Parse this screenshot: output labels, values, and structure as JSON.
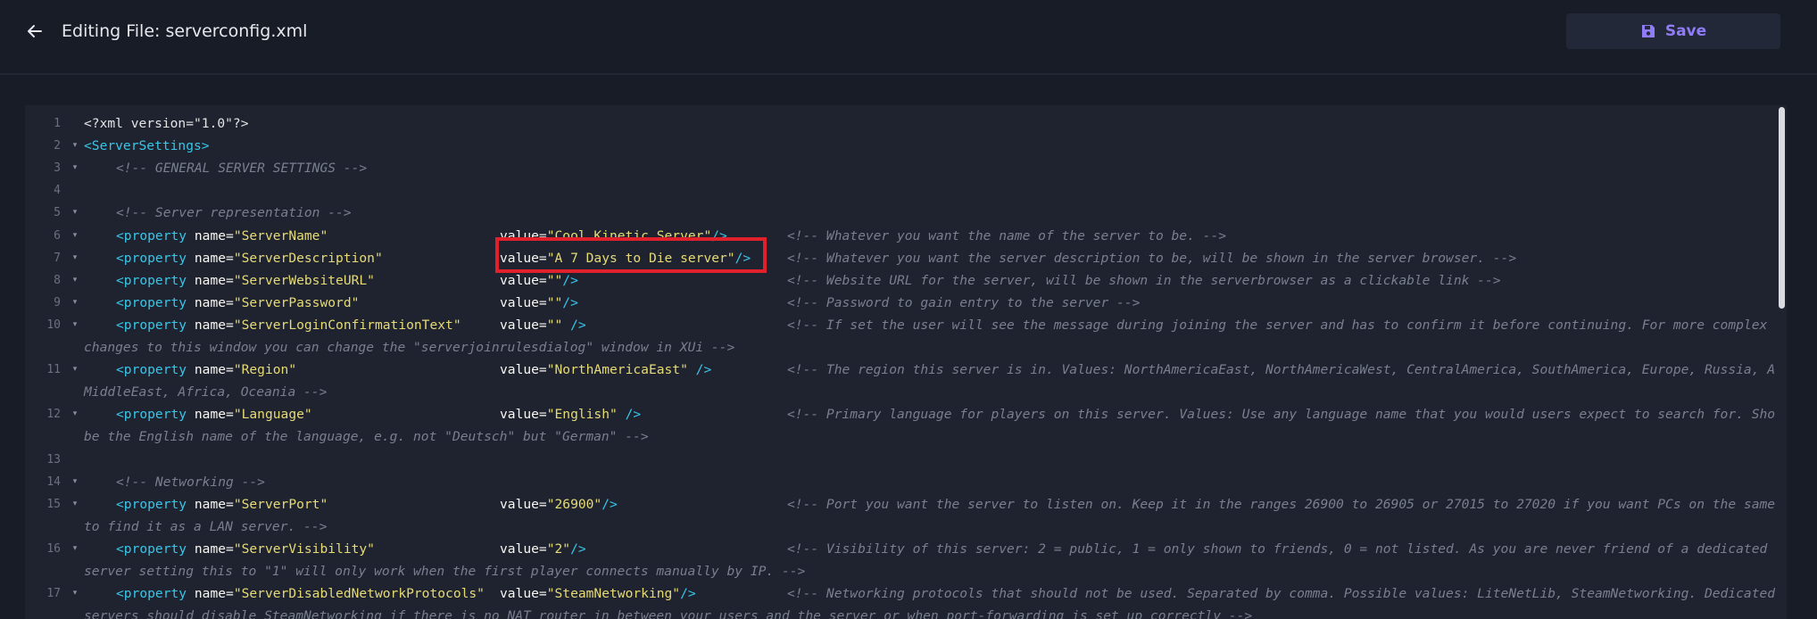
{
  "header": {
    "title": "Editing File: serverconfig.xml",
    "save_label": "Save"
  },
  "colors": {
    "accent": "#8f7cf6",
    "tag": "#38c6e8",
    "string": "#e6db74",
    "comment": "#7a7f8f",
    "highlight": "#e0202a"
  },
  "editor": {
    "lines": [
      {
        "num": "1",
        "tag": "<?xml version=\"1.0\"?>"
      },
      {
        "num": "2",
        "tag": "<ServerSettings>"
      },
      {
        "num": "3",
        "comment": "<!-- GENERAL SERVER SETTINGS -->"
      },
      {
        "num": "4"
      },
      {
        "num": "5",
        "comment": "<!-- Server representation -->"
      },
      {
        "num": "6",
        "name": "\"ServerName\"",
        "value": "\"Cool Kinetic Server\"",
        "close": "/>",
        "comment": "<!-- Whatever you want the name of the server to be. -->"
      },
      {
        "num": "7",
        "name": "\"ServerDescription\"",
        "value": "\"A 7 Days to Die server\"",
        "close": "/>",
        "comment": "<!-- Whatever you want the server description to be, will be shown in the server browser. -->"
      },
      {
        "num": "8",
        "name": "\"ServerWebsiteURL\"",
        "value": "\"\"",
        "close": "/>",
        "comment": "<!-- Website URL for the server, will be shown in the serverbrowser as a clickable link -->"
      },
      {
        "num": "9",
        "name": "\"ServerPassword\"",
        "value": "\"\"",
        "close": "/>",
        "comment": "<!-- Password to gain entry to the server -->"
      },
      {
        "num": "10",
        "name": "\"ServerLoginConfirmationText\"",
        "value": "\"\"",
        "close": " />",
        "comment": "<!-- If set the user will see the message during joining the server and has to confirm it before continuing. For more complex",
        "comment2": "changes to this window you can change the \"serverjoinrulesdialog\" window in XUi -->"
      },
      {
        "num": "11",
        "name": "\"Region\"",
        "value": "\"NorthAmericaEast\"",
        "close": " />",
        "comment": "<!-- The region this server is in. Values: NorthAmericaEast, NorthAmericaWest, CentralAmerica, SouthAmerica, Europe, Russia, Asia,",
        "comment2": "MiddleEast, Africa, Oceania -->"
      },
      {
        "num": "12",
        "name": "\"Language\"",
        "value": "\"English\"",
        "close": " />",
        "comment": "<!-- Primary language for players on this server. Values: Use any language name that you would users expect to search for. Should",
        "comment2": "be the English name of the language, e.g. not \"Deutsch\" but \"German\" -->"
      },
      {
        "num": "13"
      },
      {
        "num": "14",
        "comment": "<!-- Networking -->"
      },
      {
        "num": "15",
        "name": "\"ServerPort\"",
        "value": "\"26900\"",
        "close": "/>",
        "comment": "<!-- Port you want the server to listen on. Keep it in the ranges 26900 to 26905 or 27015 to 27020 if you want PCs on the same LAN",
        "comment2": "to find it as a LAN server. -->"
      },
      {
        "num": "16",
        "name": "\"ServerVisibility\"",
        "value": "\"2\"",
        "close": "/>",
        "comment": "<!-- Visibility of this server: 2 = public, 1 = only shown to friends, 0 = not listed. As you are never friend of a dedicated",
        "comment2": "server setting this to \"1\" will only work when the first player connects manually by IP. -->"
      },
      {
        "num": "17",
        "name": "\"ServerDisabledNetworkProtocols\"",
        "value": "\"SteamNetworking\"",
        "close": "/>",
        "comment": "<!-- Networking protocols that should not be used. Separated by comma. Possible values: LiteNetLib, SteamNetworking. Dedicated",
        "comment2": "servers should disable SteamNetworking if there is no NAT router in between your users and the server or when port-forwarding is set up correctly -->"
      }
    ],
    "kw_property": "<property",
    "kw_name": "name=",
    "kw_value": "value="
  }
}
